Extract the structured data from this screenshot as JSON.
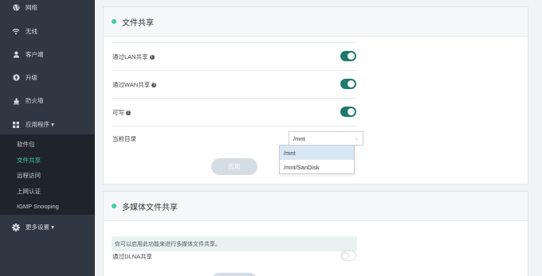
{
  "sidebar": {
    "items": [
      {
        "label": "网络",
        "icon": "globe-icon"
      },
      {
        "label": "无线",
        "icon": "wifi-icon"
      },
      {
        "label": "客户端",
        "icon": "user-icon"
      },
      {
        "label": "升级",
        "icon": "upgrade-icon"
      },
      {
        "label": "防火墙",
        "icon": "firewall-icon"
      },
      {
        "label": "应用程序 ▾",
        "icon": "apps-grid-icon"
      },
      {
        "label": "更多设置 ▾",
        "icon": "gear-icon"
      }
    ],
    "sub_items": [
      {
        "label": "软件包",
        "active": false
      },
      {
        "label": "文件共享",
        "active": true
      },
      {
        "label": "远程访问",
        "active": false
      },
      {
        "label": "上网认证",
        "active": false
      },
      {
        "label": "IGMP Snooping",
        "active": false
      }
    ]
  },
  "file_share": {
    "title": "文件共享",
    "rows": [
      {
        "label": "通过LAN共享",
        "enabled": true
      },
      {
        "label": "通过WAN共享",
        "enabled": true
      },
      {
        "label": "可写",
        "enabled": true
      }
    ],
    "dir_label": "当前目录",
    "dir_value": "/mnt",
    "dir_options": [
      "/mnt",
      "/mnt/SanDisk"
    ],
    "apply_label": "应用"
  },
  "media_share": {
    "title": "多媒体文件共享",
    "notice": "你可以启用此功能来进行多媒体文件共享。",
    "dlna_label": "通过DLNA共享",
    "dlna_enabled": false
  },
  "colors": {
    "sidebar_bg": "#2f3742",
    "accent": "#3ecf9a",
    "toggle_on": "#1f7a6e"
  }
}
